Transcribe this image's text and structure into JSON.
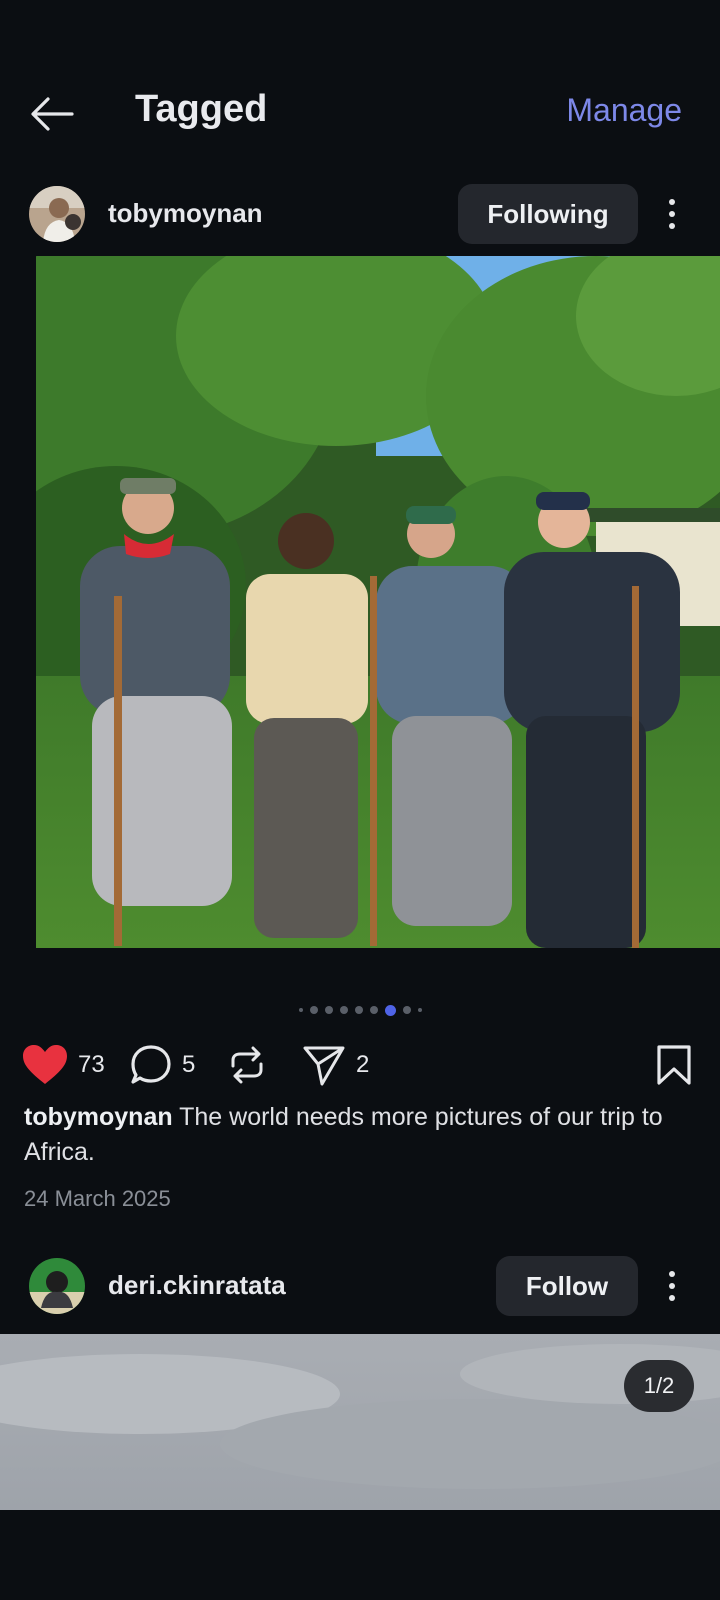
{
  "header": {
    "title": "Tagged",
    "manage_label": "Manage"
  },
  "post1": {
    "username": "tobymoynan",
    "follow_label": "Following",
    "image_alt": "Four men standing in front of green trees",
    "carousel": {
      "total": 9,
      "active_index": 6
    },
    "likes": "73",
    "comments": "5",
    "shares": "2",
    "caption_user": "tobymoynan",
    "caption_text": " The world needs more pictures of our trip to Africa.",
    "date": "24 March 2025"
  },
  "post2": {
    "username": "deri.ckinratata",
    "follow_label": "Follow",
    "page_indicator": "1/2"
  },
  "colors": {
    "accent": "#7d88e8",
    "like": "#e8323f",
    "active_dot": "#4f63e6"
  }
}
